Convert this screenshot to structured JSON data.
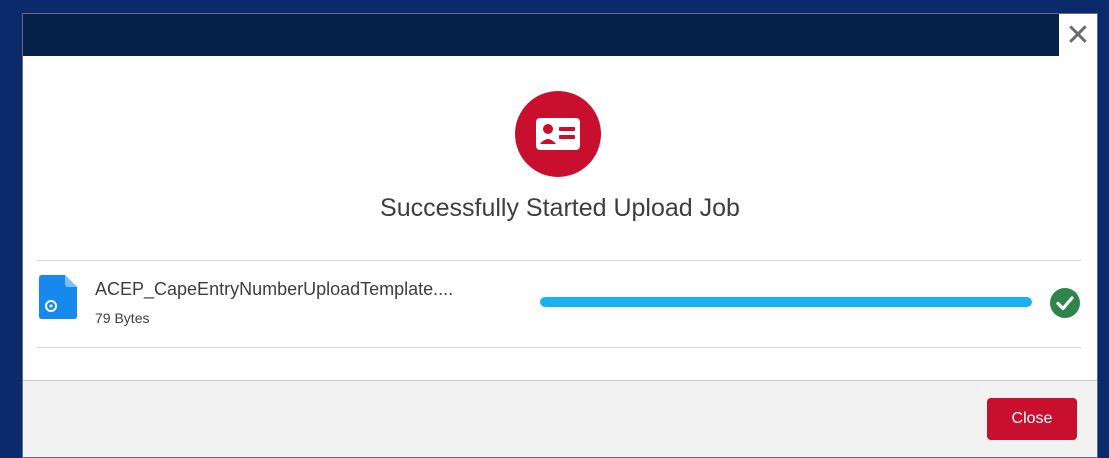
{
  "modal": {
    "close_glyph": "✕",
    "title": "Successfully Started Upload Job",
    "hero_icon": "contact-card-icon",
    "hero_color": "#c8102e"
  },
  "file": {
    "name": "ACEP_CapeEntryNumberUploadTemplate....",
    "size": "79 Bytes",
    "icon": "file-icon",
    "progress": 1.0,
    "progress_color": "#1bb0f2",
    "status_icon": "success-check-icon",
    "status_color": "#2e844a"
  },
  "footer": {
    "close_label": "Close",
    "button_color": "#c8102e"
  }
}
